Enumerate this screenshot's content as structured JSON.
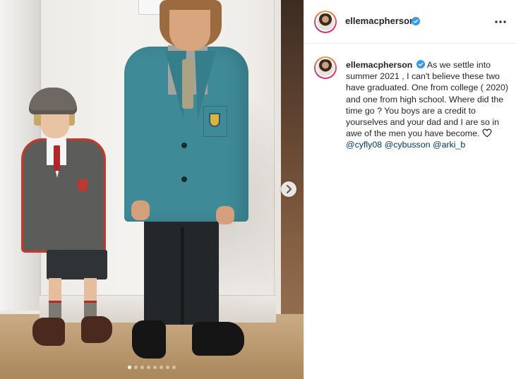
{
  "post": {
    "username": "ellemacpherson",
    "verified": true,
    "more_icon": "more-horizontal-icon",
    "caption_parts": [
      "As we settle into summer 2021 , I can't believe these two have graduated. One from college ( 2020) and one from high school. Where did the time go ? You boys are a credit to yourselves and your dad and I are so in awe of the men you have become. "
    ],
    "mentions": [
      "@cyfly08",
      "@cybusson",
      "@arki_b"
    ],
    "heart_icon": "heart-outline-icon"
  },
  "media": {
    "carousel_count": 8,
    "active_index": 0,
    "next_icon": "chevron-right-icon"
  },
  "colors": {
    "mention": "#00376b",
    "verified": "#3897f0",
    "text": "#262626"
  }
}
